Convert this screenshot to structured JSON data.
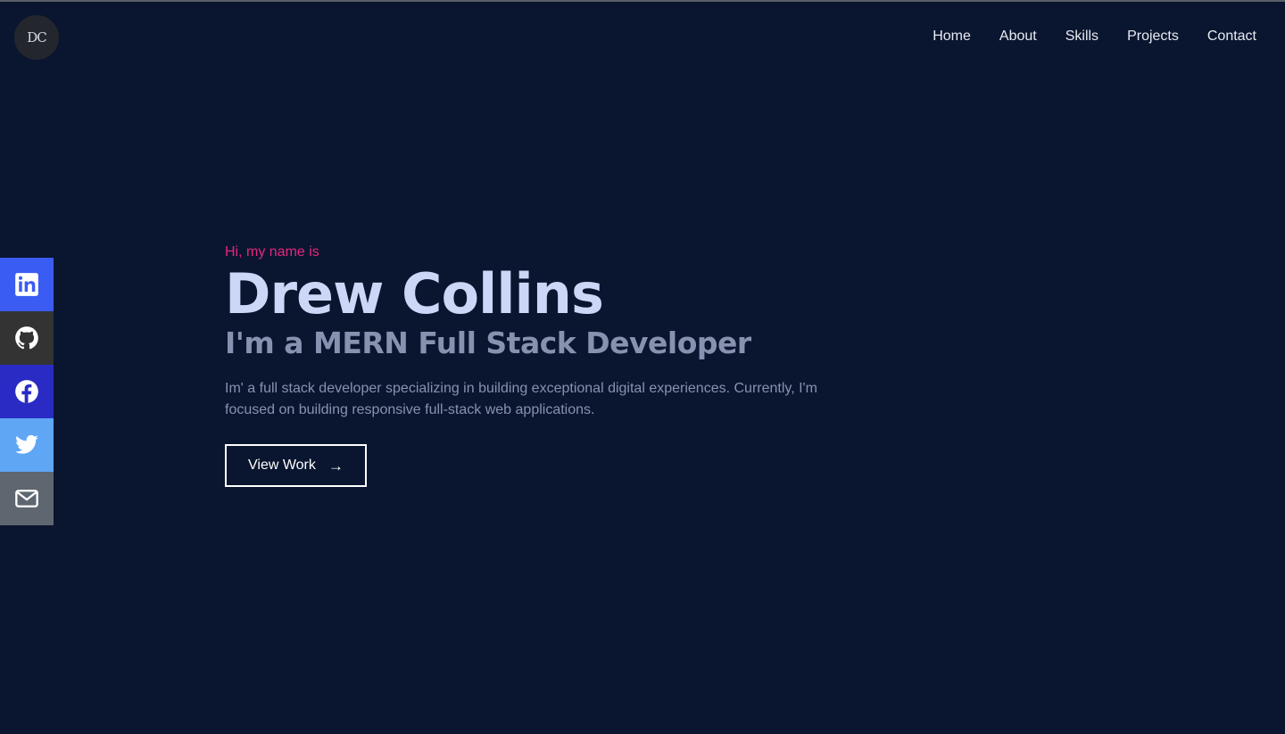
{
  "logo": {
    "text": "DC"
  },
  "nav": {
    "items": [
      "Home",
      "About",
      "Skills",
      "Projects",
      "Contact"
    ]
  },
  "social": [
    {
      "name": "linkedin-icon",
      "color": "#3b5cf2"
    },
    {
      "name": "github-icon",
      "color": "#333333"
    },
    {
      "name": "facebook-icon",
      "color": "#2a2bc4"
    },
    {
      "name": "twitter-icon",
      "color": "#5fa6f5"
    },
    {
      "name": "mail-icon",
      "color": "#5e6670"
    }
  ],
  "hero": {
    "greeting": "Hi, my name is",
    "name": "Drew Collins",
    "role": "I'm a MERN Full Stack Developer",
    "description": "Im' a full stack developer specializing in building exceptional digital experiences. Currently, I'm focused on building responsive full-stack web applications.",
    "button_label": "View Work",
    "button_icon": "arrow-right-icon"
  },
  "colors": {
    "background": "#0a1630",
    "accent": "#e6277a",
    "name": "#ccd6f6",
    "muted": "#8892b0"
  }
}
